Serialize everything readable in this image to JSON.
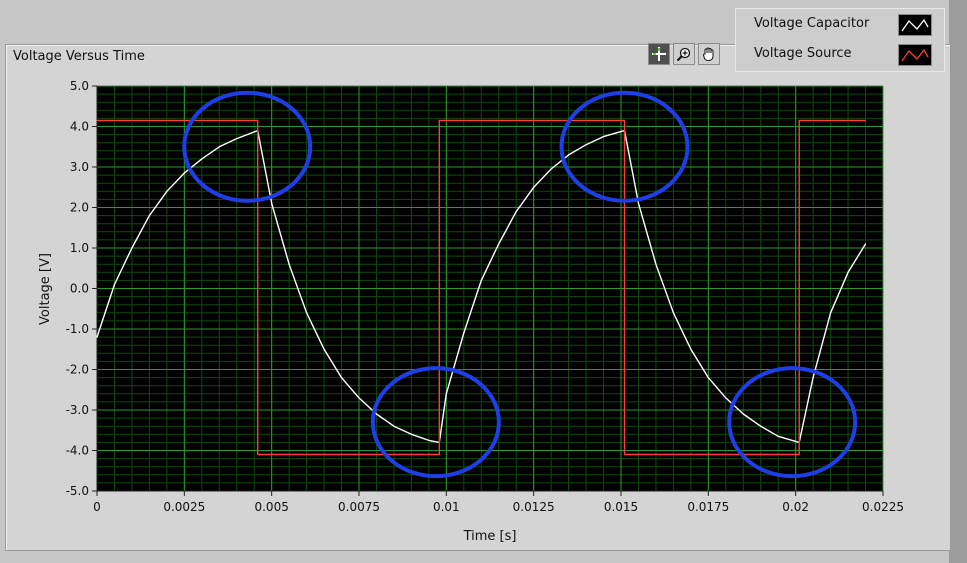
{
  "window": {
    "title": "Voltage Versus Time"
  },
  "toolbar": {
    "tools": [
      {
        "name": "cursor-crosshair-tool",
        "icon": "crosshair-icon"
      },
      {
        "name": "zoom-tool",
        "icon": "zoom-icon"
      },
      {
        "name": "pan-tool",
        "icon": "hand-icon"
      }
    ]
  },
  "legend": {
    "items": [
      {
        "label": "Voltage Capacitor",
        "color": "#ffffff"
      },
      {
        "label": "Voltage Source",
        "color": "#ff3b3b"
      }
    ]
  },
  "chart_data": {
    "type": "line",
    "title": "Voltage Versus Time",
    "xlabel": "Time [s]",
    "ylabel": "Voltage [V]",
    "xlim": [
      0,
      0.0225
    ],
    "ylim": [
      -5,
      5
    ],
    "grid": true,
    "legend_position": "top-right",
    "x_ticks": [
      "0",
      "0.0025",
      "0.005",
      "0.0075",
      "0.01",
      "0.0125",
      "0.015",
      "0.0175",
      "0.02",
      "0.0225"
    ],
    "y_ticks": [
      "-5.0",
      "-4.0",
      "-3.0",
      "-2.0",
      "-1.0",
      "0.0",
      "1.0",
      "2.0",
      "3.0",
      "4.0",
      "5.0"
    ],
    "series": [
      {
        "name": "Voltage Capacitor",
        "color": "#ffffff",
        "x": [
          0,
          0.0005,
          0.001,
          0.0015,
          0.002,
          0.0025,
          0.003,
          0.0035,
          0.004,
          0.0046,
          0.0048,
          0.005,
          0.0055,
          0.006,
          0.0065,
          0.007,
          0.0075,
          0.008,
          0.0085,
          0.009,
          0.0095,
          0.0098,
          0.01,
          0.0105,
          0.011,
          0.0115,
          0.012,
          0.0125,
          0.013,
          0.0135,
          0.014,
          0.0145,
          0.0151,
          0.0153,
          0.0155,
          0.016,
          0.0165,
          0.017,
          0.0175,
          0.018,
          0.0185,
          0.019,
          0.0195,
          0.0201,
          0.0205,
          0.021,
          0.0215,
          0.022
        ],
        "y": [
          -1.2,
          0.1,
          1.0,
          1.8,
          2.4,
          2.85,
          3.2,
          3.5,
          3.7,
          3.9,
          3.0,
          2.1,
          0.6,
          -0.6,
          -1.5,
          -2.2,
          -2.7,
          -3.1,
          -3.4,
          -3.6,
          -3.75,
          -3.8,
          -2.6,
          -1.1,
          0.2,
          1.1,
          1.9,
          2.5,
          2.95,
          3.3,
          3.55,
          3.75,
          3.9,
          3.0,
          2.1,
          0.6,
          -0.6,
          -1.5,
          -2.2,
          -2.7,
          -3.1,
          -3.4,
          -3.65,
          -3.8,
          -2.2,
          -0.6,
          0.4,
          1.1
        ]
      },
      {
        "name": "Voltage Source",
        "color": "#ff3b3b",
        "x": [
          0,
          0.0046,
          0.0046,
          0.0098,
          0.0098,
          0.0151,
          0.0151,
          0.0201,
          0.0201,
          0.022
        ],
        "y": [
          4.15,
          4.15,
          -4.1,
          -4.1,
          4.15,
          4.15,
          -4.1,
          -4.1,
          4.15,
          4.15
        ]
      }
    ],
    "annotations": [
      {
        "shape": "ellipse",
        "color": "#1f3fe6",
        "cx": 0.0043,
        "cy": 3.5
      },
      {
        "shape": "ellipse",
        "color": "#1f3fe6",
        "cx": 0.0097,
        "cy": -3.3
      },
      {
        "shape": "ellipse",
        "color": "#1f3fe6",
        "cx": 0.0151,
        "cy": 3.5
      },
      {
        "shape": "ellipse",
        "color": "#1f3fe6",
        "cx": 0.0199,
        "cy": -3.3
      }
    ]
  }
}
